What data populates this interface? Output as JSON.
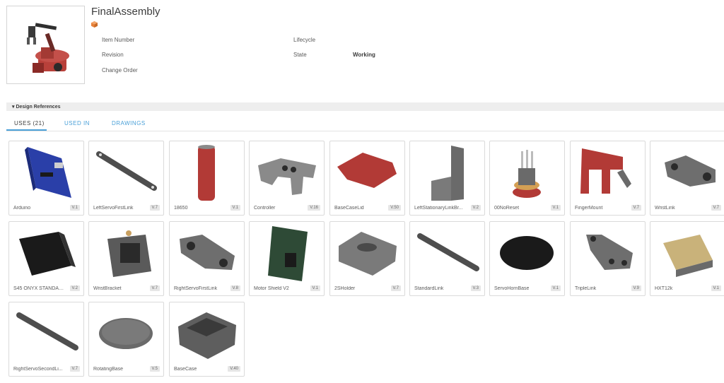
{
  "header": {
    "title": "FinalAssembly",
    "item_number_label": "Item Number",
    "revision_label": "Revision",
    "change_order_label": "Change Order",
    "lifecycle_label": "Lifecycle",
    "state_label": "State",
    "state_value": "Working"
  },
  "section": {
    "title": "▾ Design References"
  },
  "tabs": {
    "uses": "USES (21)",
    "used_in": "USED IN",
    "drawings": "DRAWINGS"
  },
  "parts": [
    {
      "name": "Arduino",
      "version": "V.1"
    },
    {
      "name": "LeftServoFirstLink",
      "version": "V.7"
    },
    {
      "name": "18650",
      "version": "V.1"
    },
    {
      "name": "Controller",
      "version": "V.16"
    },
    {
      "name": "BaseCaseLid",
      "version": "V.50"
    },
    {
      "name": "LeftStationaryLinkBr...",
      "version": "V.2"
    },
    {
      "name": "00NoReset",
      "version": "V.1"
    },
    {
      "name": "FingerMount",
      "version": "V.7"
    },
    {
      "name": "WristLink",
      "version": "V.7"
    },
    {
      "name": "S45 ONYX STANDAR...",
      "version": "V.2"
    },
    {
      "name": "WristBracket",
      "version": "V.7"
    },
    {
      "name": "RightServoFirstLink",
      "version": "V.8"
    },
    {
      "name": "Motor Shield V2",
      "version": "V.1"
    },
    {
      "name": "2SHolder",
      "version": "V.7"
    },
    {
      "name": "StandardLink",
      "version": "V.3"
    },
    {
      "name": "ServoHornBase",
      "version": "V.1"
    },
    {
      "name": "TripleLink",
      "version": "V.9"
    },
    {
      "name": "HXT12k",
      "version": "V.1"
    },
    {
      "name": "RightServoSecondLi...",
      "version": "V.7"
    },
    {
      "name": "RotatingBase",
      "version": "V.5"
    },
    {
      "name": "BaseCase",
      "version": "V.40"
    }
  ]
}
